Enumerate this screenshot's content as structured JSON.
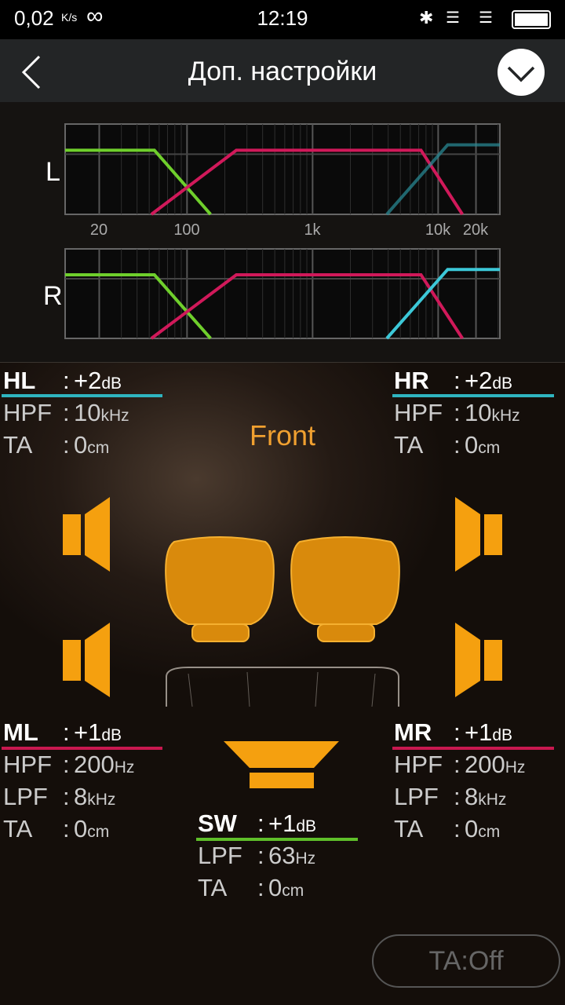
{
  "status_bar": {
    "speed": "0,02",
    "speed_unit": "K/s",
    "infinity_icon": "∞",
    "time": "12:19",
    "icons": [
      "bluetooth-icon",
      "3g-signal-icon",
      "signal-icon",
      "battery-icon"
    ]
  },
  "header": {
    "title": "Доп. настройки",
    "back_icon": "chevron-left-icon",
    "confirm_icon": "check-circle-icon"
  },
  "chart_data": [
    {
      "type": "line",
      "title": "",
      "channel_label": "L",
      "xscale": "log",
      "xlabel": "",
      "ylabel": "",
      "xlim": [
        10.7,
        31000
      ],
      "ylim": [
        0,
        1
      ],
      "xticks": [
        20,
        100,
        1000,
        10000,
        20000
      ],
      "xtick_labels": [
        "20",
        "100",
        "1k",
        "10k",
        "20k"
      ],
      "grid": true,
      "series": [
        {
          "color": "#6fcf2c",
          "points": [
            [
              10.7,
              0.71
            ],
            [
              55,
              0.71
            ],
            [
              154,
              0
            ]
          ]
        },
        {
          "color": "#d0195a",
          "points": [
            [
              52,
              0
            ],
            [
              247,
              0.71
            ],
            [
              7300,
              0.71
            ],
            [
              15600,
              0
            ]
          ]
        },
        {
          "color": "#2a8f9a",
          "faded": true,
          "points": [
            [
              3900,
              0
            ],
            [
              11900,
              0.77
            ],
            [
              31000,
              0.77
            ]
          ]
        }
      ]
    },
    {
      "type": "line",
      "title": "",
      "channel_label": "R",
      "xscale": "log",
      "xlabel": "",
      "ylabel": "",
      "xlim": [
        10.7,
        31000
      ],
      "ylim": [
        0,
        1
      ],
      "grid": true,
      "series": [
        {
          "color": "#6fcf2c",
          "points": [
            [
              10.7,
              0.71
            ],
            [
              55,
              0.71
            ],
            [
              154,
              0
            ]
          ]
        },
        {
          "color": "#d0195a",
          "points": [
            [
              52,
              0
            ],
            [
              247,
              0.71
            ],
            [
              7300,
              0.71
            ],
            [
              15600,
              0
            ]
          ]
        },
        {
          "color": "#3cc8d8",
          "points": [
            [
              3900,
              0
            ],
            [
              11900,
              0.77
            ],
            [
              31000,
              0.77
            ]
          ]
        }
      ]
    }
  ],
  "zone_label": "Front",
  "channels": {
    "hl": {
      "name": "HL",
      "gain": "+2",
      "gain_unit": "dB",
      "color": "#2fb5c0",
      "rows": [
        {
          "k": "HPF",
          "v": "10",
          "u": "kHz"
        },
        {
          "k": "TA",
          "v": "0",
          "u": "cm"
        }
      ]
    },
    "hr": {
      "name": "HR",
      "gain": "+2",
      "gain_unit": "dB",
      "color": "#2fb5c0",
      "rows": [
        {
          "k": "HPF",
          "v": "10",
          "u": "kHz"
        },
        {
          "k": "TA",
          "v": "0",
          "u": "cm"
        }
      ]
    },
    "ml": {
      "name": "ML",
      "gain": "+1",
      "gain_unit": "dB",
      "color": "#c8184f",
      "rows": [
        {
          "k": "HPF",
          "v": "200",
          "u": "Hz"
        },
        {
          "k": "LPF",
          "v": "8",
          "u": "kHz"
        },
        {
          "k": "TA",
          "v": "0",
          "u": "cm"
        }
      ]
    },
    "mr": {
      "name": "MR",
      "gain": "+1",
      "gain_unit": "dB",
      "color": "#c8184f",
      "rows": [
        {
          "k": "HPF",
          "v": "200",
          "u": "Hz"
        },
        {
          "k": "LPF",
          "v": "8",
          "u": "kHz"
        },
        {
          "k": "TA",
          "v": "0",
          "u": "cm"
        }
      ]
    },
    "sw": {
      "name": "SW",
      "gain": "+1",
      "gain_unit": "dB",
      "color": "#5fbf2a",
      "rows": [
        {
          "k": "LPF",
          "v": "63",
          "u": "Hz"
        },
        {
          "k": "TA",
          "v": "0",
          "u": "cm"
        }
      ]
    }
  },
  "colors": {
    "accent": "#f5a00f",
    "seat": "#d98a0c"
  },
  "ta_button": "TA:Off"
}
